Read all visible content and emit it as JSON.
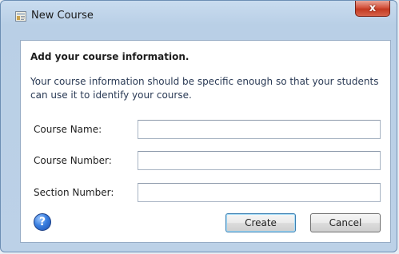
{
  "window": {
    "title": "New Course",
    "close_label": "x"
  },
  "content": {
    "heading": "Add your course information.",
    "description": "Your course information should be specific enough so that your students can use it to identify your course."
  },
  "fields": [
    {
      "label": "Course Name:",
      "value": "",
      "placeholder": ""
    },
    {
      "label": "Course Number:",
      "value": "",
      "placeholder": ""
    },
    {
      "label": "Section Number:",
      "value": "",
      "placeholder": ""
    }
  ],
  "buttons": {
    "create": "Create",
    "cancel": "Cancel",
    "help": "?"
  },
  "icons": {
    "app": "course-app-icon",
    "help": "help-icon",
    "close": "close-icon"
  },
  "colors": {
    "titlebar": "#c9dcef",
    "close_button": "#c33a22",
    "help_icon": "#3a7fe0",
    "default_button_border": "#3c7fb1"
  }
}
